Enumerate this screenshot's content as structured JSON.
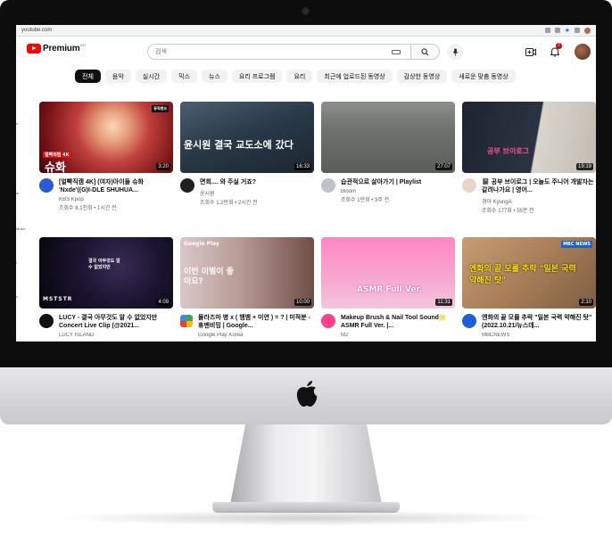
{
  "browser": {
    "url": "youtube.com"
  },
  "header": {
    "logo_text": "Premium",
    "logo_region": "KR",
    "search_placeholder": "검색",
    "notification_count": "2"
  },
  "chips": [
    "전체",
    "음악",
    "실시간",
    "믹스",
    "뉴스",
    "요리 프로그램",
    "요리",
    "최근에 업로드된 동영상",
    "감상한 동영상",
    "새로운 맞춤 동영상"
  ],
  "sidebar": {
    "labels": [
      "s",
      "ls",
      "Music",
      "l",
      "s"
    ]
  },
  "videos": [
    {
      "title": "[얼빡직캠 4K] (여자)아이들 슈화 'Nxde'((G)I-DLE SHUHUA...",
      "channel": "KBS Kpop",
      "stats": "조회수 8.1천회 • 1시간 전",
      "duration": "3:20",
      "thumb_caption": "슈화",
      "thumb_tag": "얼빡직캠 4K",
      "thumb_logo": "뮤직뱅크"
    },
    {
      "title": "면회.... 와 주실 거죠?",
      "channel": "윤시원",
      "stats": "조회수 1.2만회 • 2시간 전",
      "duration": "16:33",
      "thumb_caption": "윤시원 결국 교도소에 갔다"
    },
    {
      "title": "습관적으로 살아가기 | Playlist",
      "channel": "Bloom",
      "stats": "조회수 1만회 • 3주 전",
      "duration": "27:07"
    },
    {
      "title": "📓 공부 브이로그 | 오늘도 주니어 개발자는 갈려나가요 | 영어...",
      "channel": "경아 KyungA",
      "stats": "조회수 177회 • 55분 전",
      "duration": "19:19",
      "thumb_caption": "공부 브이로그"
    },
    {
      "title": "LUCY - 결국 아무것도 알 수 없었지만 Concert Live Clip (@2021...",
      "channel": "LUCY ISLAND",
      "stats": "",
      "duration": "4:09",
      "thumb_caption": "결국 아무것도 알 수 없었지만",
      "thumb_logo": "MSTSTR"
    },
    {
      "title": "뮬라즈마 병 x ( 뱀뱀 + 미연 ) = ? | 미적분 - 휴멘비밍 | Google...",
      "channel": "Google Play Korea",
      "stats": "",
      "duration": "10:00",
      "thumb_caption": "이번 이별이 좋아요?",
      "thumb_logo": "Google Play"
    },
    {
      "title": "Makeup Brush & Nail Tool Sound🌝 ASMR Full Ver. |...",
      "channel": "M2",
      "stats": "",
      "duration": "11:31",
      "thumb_caption": "ASMR Full Ver."
    },
    {
      "title": "엔화의 끝 모를 추락 \"일본 국력 약해진 탓\" (2022.10.21/뉴스데...",
      "channel": "MBCNEWS",
      "stats": "",
      "duration": "2:10",
      "thumb_caption": "엔화의 끝 모를 추락 \"일본 국력 약해진 탓\"",
      "thumb_logo": "MBC NEWS"
    }
  ],
  "colors": {
    "brand_red": "#ff0000",
    "chip_active": "#0f0f0f",
    "chip_bg": "#f2f2f2",
    "bezel": "#0d0d0d"
  }
}
